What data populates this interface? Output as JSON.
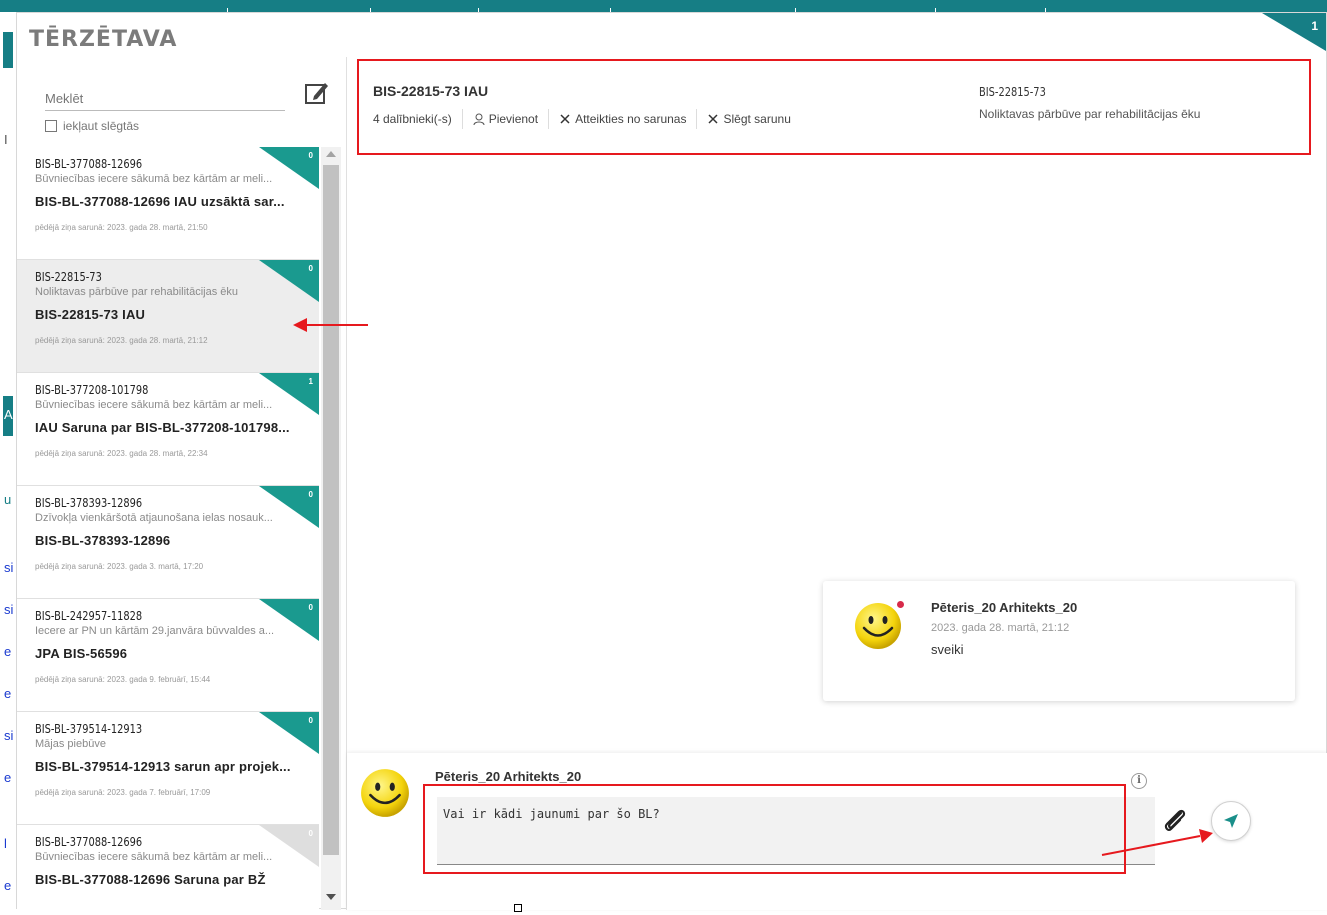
{
  "app": {
    "title": "TĒRZĒTAVA",
    "corner_badge": "1"
  },
  "background": {
    "fragments": [
      "I",
      "A",
      "u",
      "si",
      "si",
      "e",
      "e",
      "si",
      "e",
      "l",
      "e"
    ]
  },
  "search": {
    "placeholder": "Meklēt",
    "include_closed_label": "iekļaut slēgtās"
  },
  "conversations": [
    {
      "code": "BIS-BL-377088-12696",
      "description": "Būvniecības iecere sākumā bez kārtām ar meli...",
      "title": "BIS-BL-377088-12696 IAU uzsāktā sar...",
      "last_message": "pēdējā ziņa sarunā: 2023. gada 28. martā, 21:50",
      "badge": "0",
      "badge_color": "#1a9a8f",
      "selected": false
    },
    {
      "code": "BIS-22815-73",
      "description": "Noliktavas pārbūve par rehabilitācijas ēku",
      "title": "BIS-22815-73 IAU",
      "last_message": "pēdējā ziņa sarunā: 2023. gada 28. martā, 21:12",
      "badge": "0",
      "badge_color": "#1a9a8f",
      "selected": true
    },
    {
      "code": "BIS-BL-377208-101798",
      "description": "Būvniecības iecere sākumā bez kārtām ar meli...",
      "title": "IAU Saruna par BIS-BL-377208-101798...",
      "last_message": "pēdējā ziņa sarunā: 2023. gada 28. martā, 22:34",
      "badge": "1",
      "badge_color": "#1a9a8f",
      "selected": false
    },
    {
      "code": "BIS-BL-378393-12896",
      "description": "Dzīvokļa vienkāršotā atjaunošana ielas nosauk...",
      "title": "BIS-BL-378393-12896",
      "last_message": "pēdējā ziņa sarunā: 2023. gada 3. martā, 17:20",
      "badge": "0",
      "badge_color": "#1a9a8f",
      "selected": false
    },
    {
      "code": "BIS-BL-242957-11828",
      "description": "Iecere ar PN un kārtām 29.janvāra būvvaldes a...",
      "title": "JPA BIS-56596",
      "last_message": "pēdējā ziņa sarunā: 2023. gada 9. februārī, 15:44",
      "badge": "0",
      "badge_color": "#1a9a8f",
      "selected": false
    },
    {
      "code": "BIS-BL-379514-12913",
      "description": "Mājas piebūve",
      "title": "BIS-BL-379514-12913 sarun apr projek...",
      "last_message": "pēdējā ziņa sarunā: 2023. gada 7. februārī, 17:09",
      "badge": "0",
      "badge_color": "#1a9a8f",
      "selected": false
    },
    {
      "code": "BIS-BL-377088-12696",
      "description": "Būvniecības iecere sākumā bez kārtām ar meli...",
      "title": "BIS-BL-377088-12696 Saruna par BŽ",
      "last_message": "",
      "badge": "0",
      "badge_color": "#dedede",
      "selected": false
    }
  ],
  "active_conversation": {
    "title": "BIS-22815-73 IAU",
    "participants": "4 dalībnieki(-s)",
    "add_label": "Pievienot",
    "leave_label": "Atteikties no sarunas",
    "close_label": "Slēgt sarunu",
    "case_code": "BIS-22815-73",
    "case_description": "Noliktavas pārbūve par rehabilitācijas ēku"
  },
  "messages": [
    {
      "author": "Pēteris_20 Arhitekts_20",
      "time": "2023. gada 28. martā, 21:12",
      "text": "sveiki"
    }
  ],
  "composer": {
    "author": "Pēteris_20 Arhitekts_20",
    "value": "Vai ir kādi jaunumi par šo BL?",
    "info": "i"
  },
  "colors": {
    "accent": "#167e85",
    "badge": "#1a9a8f",
    "annotation": "#e6191e"
  }
}
